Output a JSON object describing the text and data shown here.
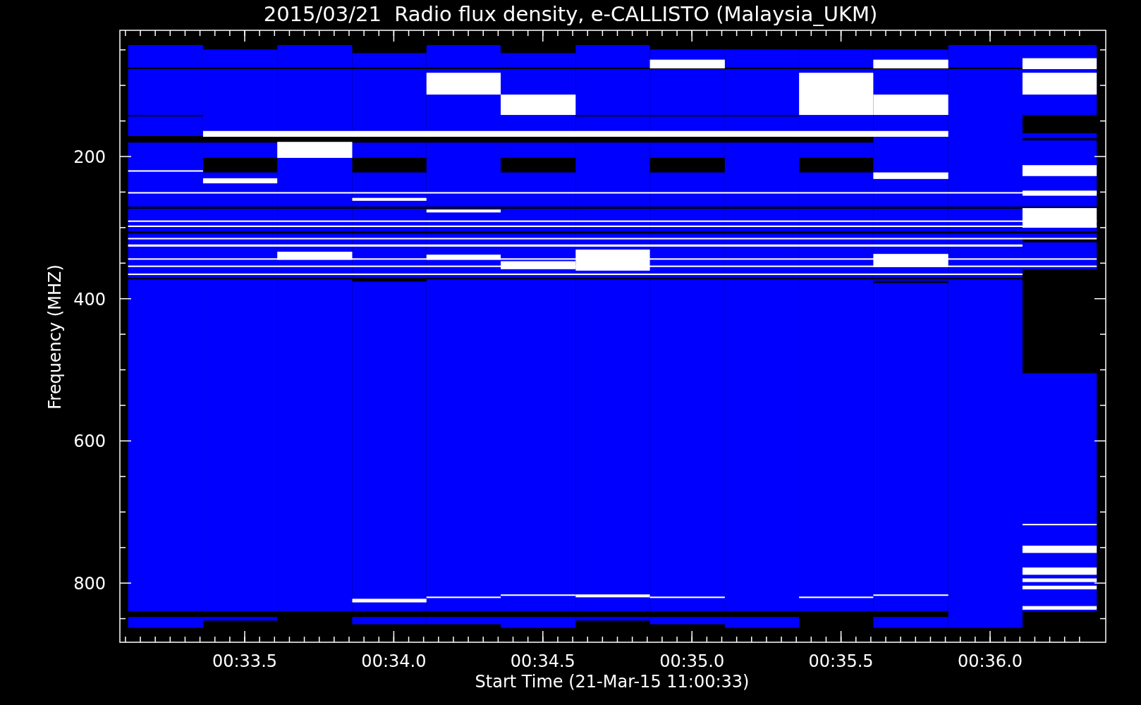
{
  "title": "2015/03/21  Radio flux density, e-CALLISTO (Malaysia_UKM)",
  "ylabel": "Frequency (MHZ)",
  "xlabel": "Start Time (21-Mar-15 11:00:33)",
  "yticks": [
    "200",
    "400",
    "600",
    "800"
  ],
  "xticks": [
    "00:33.5",
    "00:34.0",
    "00:34.5",
    "00:35.0",
    "00:35.5",
    "00:36.0"
  ]
}
